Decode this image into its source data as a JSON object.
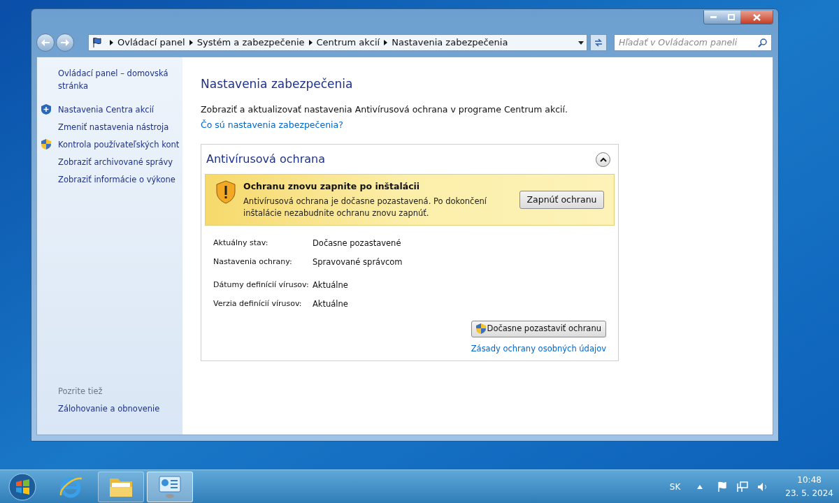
{
  "window": {
    "controls": [
      {
        "kind": "minimize"
      },
      {
        "kind": "maximize"
      },
      {
        "kind": "close"
      }
    ]
  },
  "address_bar": {
    "breadcrumbs": [
      "Ovládací panel",
      "Systém a zabezpečenie",
      "Centrum akcií",
      "Nastavenia zabezpečenia"
    ]
  },
  "search": {
    "placeholder": "Hľadať v Ovládacom paneli"
  },
  "sidebar": {
    "items": [
      {
        "label": "Ovládací panel – domovská stránka",
        "kind": "plain"
      },
      {
        "label": "Nastavenia Centra akcií",
        "kind": "action-shield"
      },
      {
        "label": "Zmeniť nastavenia nástroja",
        "kind": "plain"
      },
      {
        "label": "Kontrola používateľských kont",
        "kind": "uac-shield"
      },
      {
        "label": "Zobraziť archivované správy",
        "kind": "plain"
      },
      {
        "label": "Zobraziť informácie o výkone",
        "kind": "plain"
      }
    ],
    "see_also": {
      "title": "Pozrite tiež",
      "items": [
        "Zálohovanie a obnovenie"
      ]
    }
  },
  "main": {
    "title": "Nastavenia zabezpečenia",
    "description": "Zobraziť a aktualizovať nastavenia Antivírusová ochrana v programe Centrum akcií.",
    "help_link": "Čo sú nastavenia zabezpečenia?",
    "panel": {
      "title": "Antivírusová ochrana",
      "expanded": true,
      "alert": {
        "title": "Ochranu znovu zapnite po inštalácii",
        "text": "Antivírusová ochrana je dočasne pozastavená. Po dokončení inštalácie nezabudnite ochranu znovu zapnúť.",
        "button": "Zapnúť ochranu"
      },
      "rows": [
        {
          "label": "Aktuálny stav:",
          "value": "Dočasne pozastavené"
        },
        {
          "label": "Nastavenia ochrany:",
          "value": "Spravované správcom"
        },
        {
          "label": "Dátumy definícií vírusov:",
          "value": "Aktuálne"
        },
        {
          "label": "Verzia definícií vírusov:",
          "value": "Aktuálne"
        }
      ],
      "button": "Dočasne pozastaviť ochranu",
      "link": "Zásady ochrany osobných údajov"
    }
  },
  "taskbar": {
    "items": [
      {
        "kind": "start",
        "selected": false
      },
      {
        "kind": "browser",
        "selected": false
      },
      {
        "kind": "folder",
        "selected": false
      },
      {
        "kind": "control-panel",
        "selected": true
      }
    ],
    "tray": {
      "language": "SK",
      "time": "10:48",
      "date": "23. 5. 2024"
    }
  }
}
